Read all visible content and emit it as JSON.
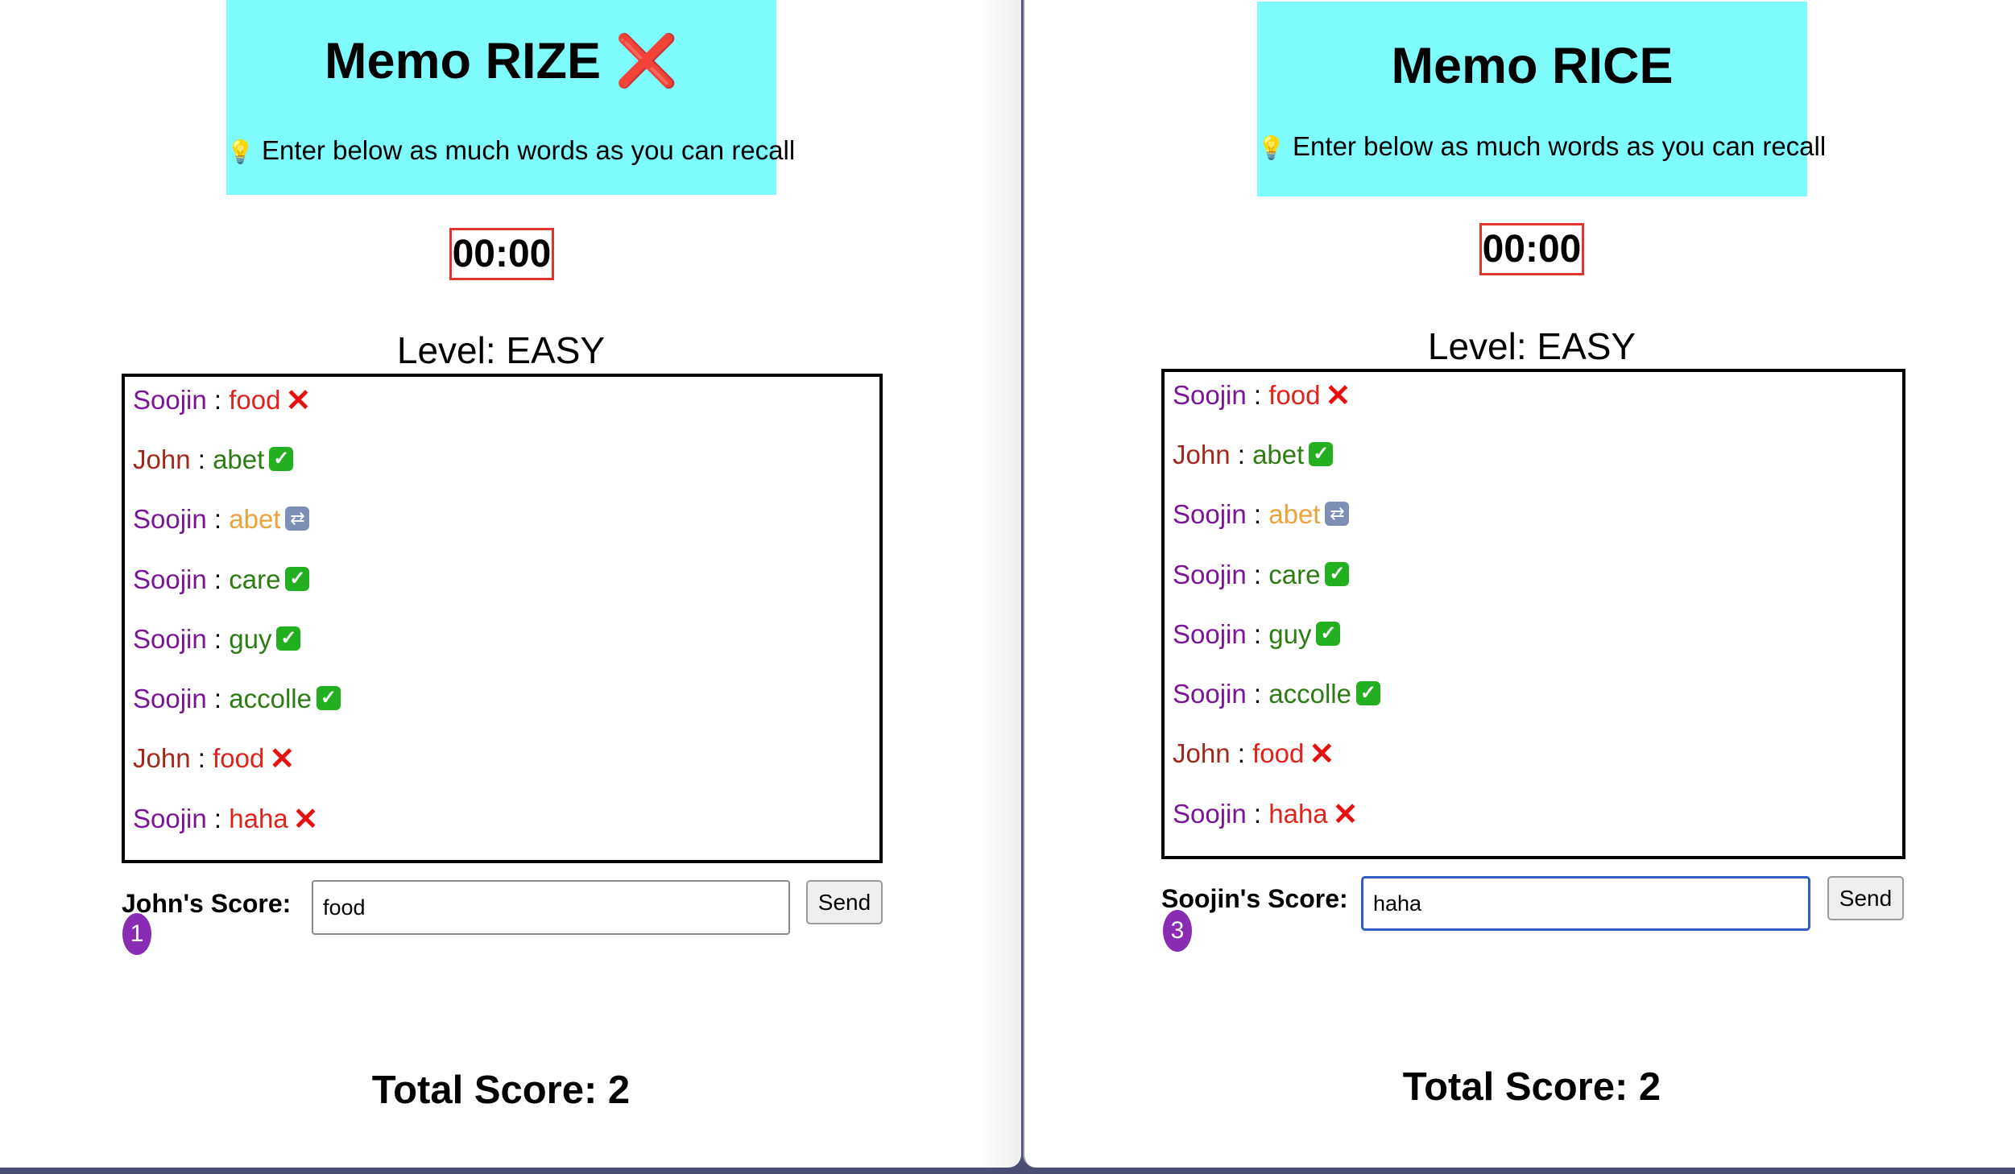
{
  "left": {
    "title": "Memo RIZE",
    "title_icon": "❌",
    "hint_icon": "💡",
    "hint": "Enter below as much words as you can recall",
    "timer": "00:00",
    "level": "Level: EASY",
    "entries": [
      {
        "player": "Soojin",
        "sep": " : ",
        "word": "food",
        "status": "invalid"
      },
      {
        "player": "John",
        "sep": " : ",
        "word": "abet",
        "status": "valid"
      },
      {
        "player": "Soojin",
        "sep": " : ",
        "word": "abet",
        "status": "duplicate"
      },
      {
        "player": "Soojin",
        "sep": " : ",
        "word": "care",
        "status": "valid"
      },
      {
        "player": "Soojin",
        "sep": " : ",
        "word": "guy",
        "status": "valid"
      },
      {
        "player": "Soojin",
        "sep": " : ",
        "word": "accolle",
        "status": "valid"
      },
      {
        "player": "John",
        "sep": " : ",
        "word": "food",
        "status": "invalid"
      },
      {
        "player": "Soojin",
        "sep": " : ",
        "word": "haha",
        "status": "invalid"
      }
    ],
    "score_label": "John's Score:",
    "score_badge": "1",
    "input_value": "food",
    "send_label": "Send",
    "total": "Total Score: 2"
  },
  "right": {
    "title": "Memo RICE",
    "hint_icon": "💡",
    "hint": "Enter below as much words as you can recall",
    "timer": "00:00",
    "level": "Level: EASY",
    "entries": [
      {
        "player": "Soojin",
        "sep": " : ",
        "word": "food",
        "status": "invalid"
      },
      {
        "player": "John",
        "sep": " : ",
        "word": "abet",
        "status": "valid"
      },
      {
        "player": "Soojin",
        "sep": " : ",
        "word": "abet",
        "status": "duplicate"
      },
      {
        "player": "Soojin",
        "sep": " : ",
        "word": "care",
        "status": "valid"
      },
      {
        "player": "Soojin",
        "sep": " : ",
        "word": "guy",
        "status": "valid"
      },
      {
        "player": "Soojin",
        "sep": " : ",
        "word": "accolle",
        "status": "valid"
      },
      {
        "player": "John",
        "sep": " : ",
        "word": "food",
        "status": "invalid"
      },
      {
        "player": "Soojin",
        "sep": " : ",
        "word": "haha",
        "status": "invalid"
      }
    ],
    "score_label": "Soojin's Score:",
    "score_badge": "3",
    "input_value": "haha",
    "send_label": "Send",
    "total": "Total Score: 2"
  },
  "status_icons": {
    "valid": "check-mark-icon",
    "invalid": "cross-mark-icon",
    "duplicate": "repeat-icon"
  },
  "colors": {
    "header_bg": "#7dfbfd",
    "player_soojin": "#7a1596",
    "player_john": "#a3281c",
    "word_valid": "#2d7b13",
    "word_invalid": "#e0221b",
    "word_duplicate": "#eea23a",
    "timer_border": "#e0342f",
    "badge_bg": "#8a2bb3",
    "active_input_border": "#2f5cc7"
  }
}
